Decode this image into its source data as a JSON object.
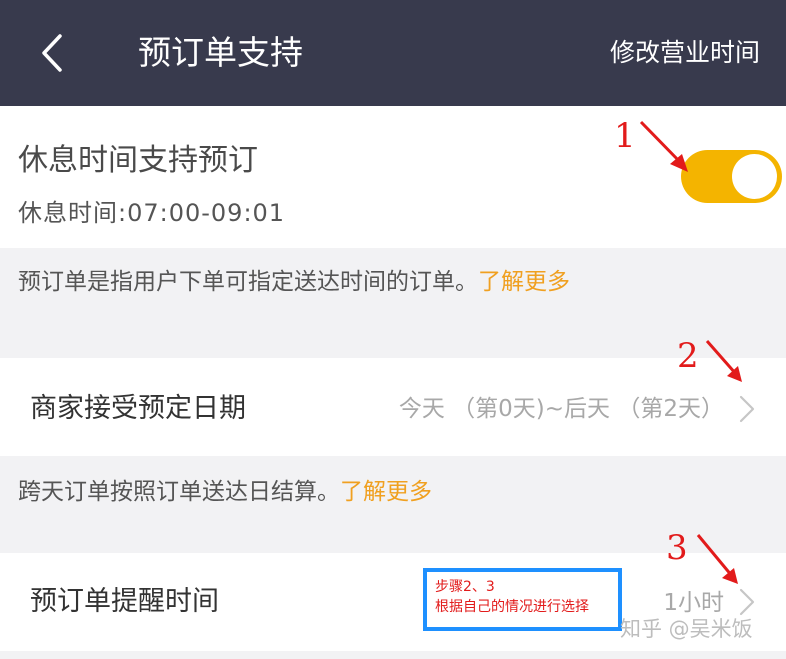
{
  "header": {
    "title": "预订单支持",
    "edit_hours_label": "修改营业时间"
  },
  "rest_support": {
    "title": "休息时间支持预订",
    "rest_time": "休息时间:07:00-09:01",
    "toggle_on": true
  },
  "note1": {
    "text": "预订单是指用户下单可指定送达时间的订单。",
    "link": "了解更多"
  },
  "accept_dates": {
    "label": "商家接受预定日期",
    "value": "今天 （第0天)~后天 （第2天）"
  },
  "note2": {
    "text": "跨天订单按照订单送达日结算。",
    "link": "了解更多"
  },
  "reminder": {
    "label": "预订单提醒时间",
    "value": "1小时"
  },
  "annotations": {
    "num1": "1",
    "num2": "2",
    "num3": "3",
    "step_line1": "步骤2、3",
    "step_line2": "根据自己的情况进行选择"
  },
  "watermark": "知乎 @吴米饭",
  "colors": {
    "header_bg": "#383a4d",
    "toggle_on": "#f4b400",
    "link": "#f0a020",
    "annotation": "#e21b1b",
    "box_border": "#1e90ff"
  }
}
